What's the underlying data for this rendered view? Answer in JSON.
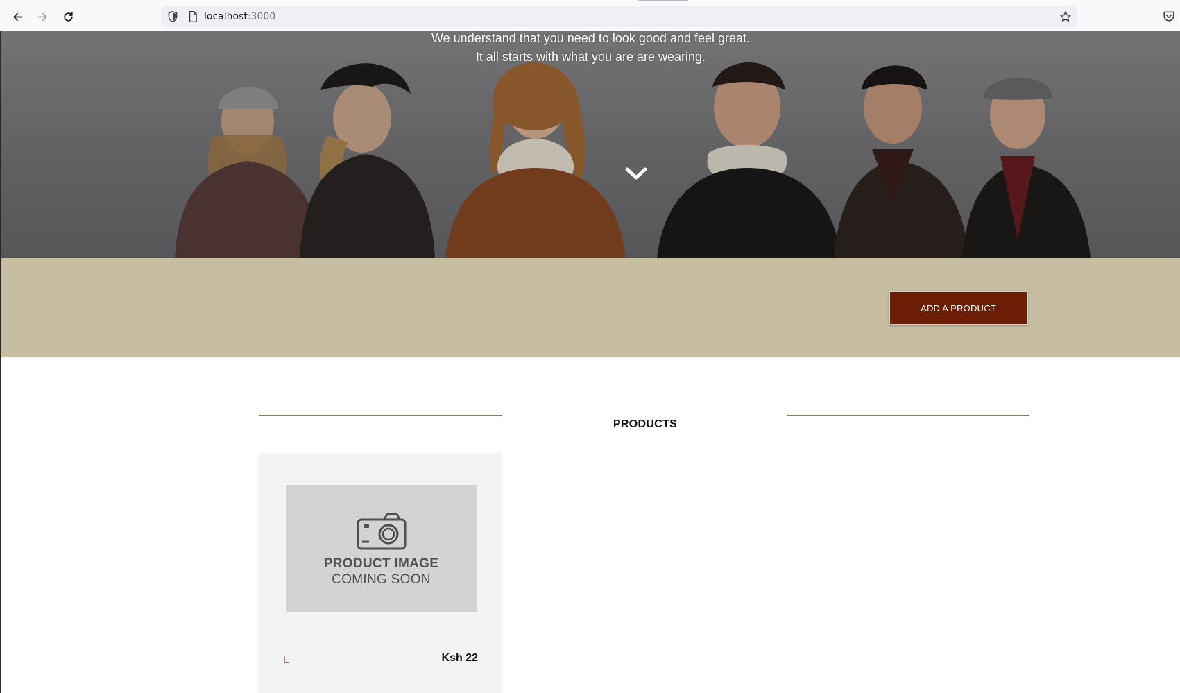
{
  "browser": {
    "url_host": "localhost",
    "url_port": ":3000"
  },
  "hero": {
    "line1": "We understand that you need to look good and feel great.",
    "line2": "It all starts with what you are are wearing."
  },
  "band": {
    "add_button_label": "ADD A PRODUCT"
  },
  "products": {
    "section_title": "PRODUCTS",
    "items": [
      {
        "placeholder_line1": "PRODUCT IMAGE",
        "placeholder_line2": "COMING SOON",
        "name": "L",
        "price": "Ksh 22"
      }
    ]
  },
  "colors": {
    "accent": "#6b1d05",
    "band": "#c7bda3",
    "rule": "#8a7a60"
  }
}
